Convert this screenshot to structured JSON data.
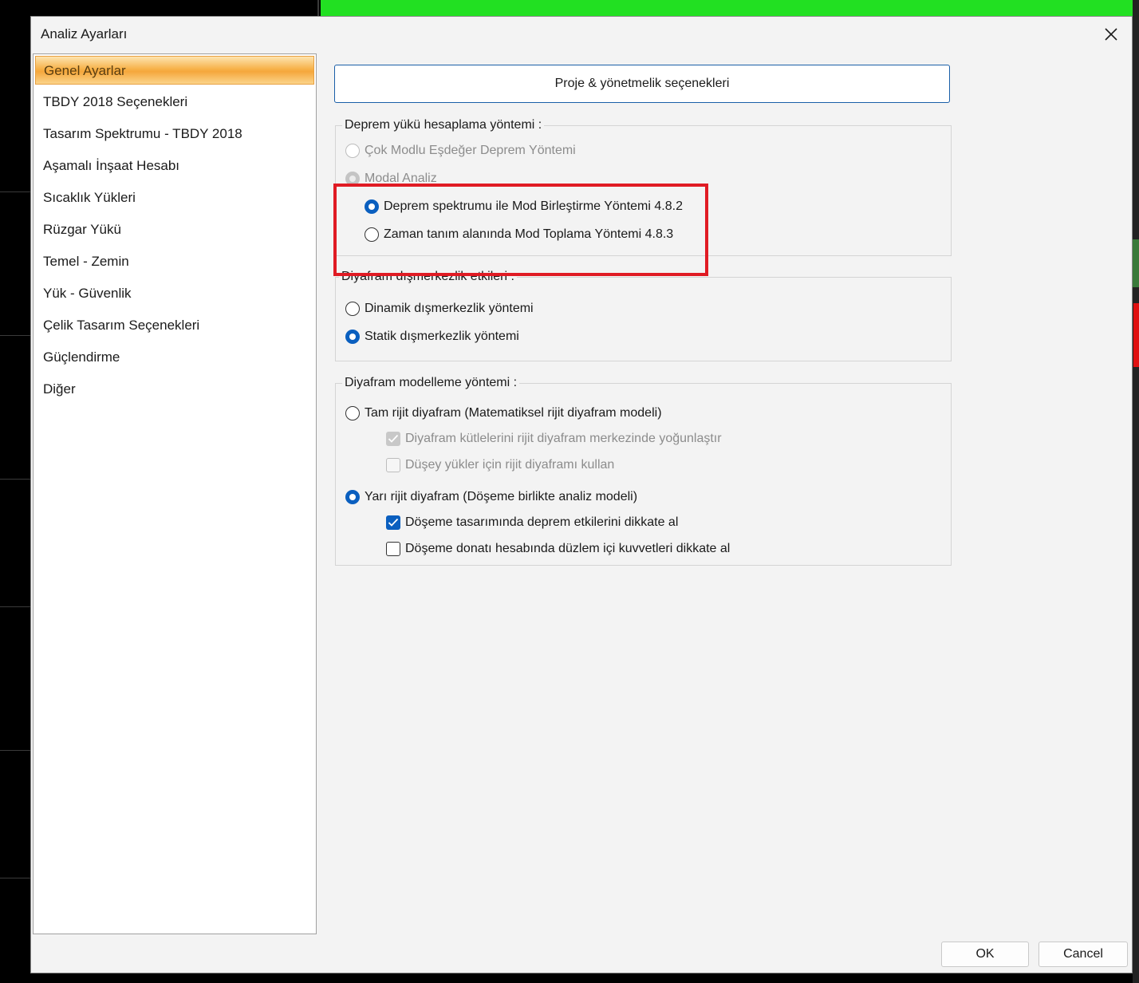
{
  "window": {
    "title": "Analiz Ayarları"
  },
  "sidebar": {
    "items": [
      {
        "label": "Genel Ayarlar",
        "active": true
      },
      {
        "label": "TBDY 2018 Seçenekleri"
      },
      {
        "label": "Tasarım Spektrumu - TBDY 2018"
      },
      {
        "label": "Aşamalı İnşaat Hesabı"
      },
      {
        "label": "Sıcaklık Yükleri"
      },
      {
        "label": "Rüzgar Yükü"
      },
      {
        "label": "Temel - Zemin"
      },
      {
        "label": "Yük - Güvenlik"
      },
      {
        "label": "Çelik Tasarım Seçenekleri"
      },
      {
        "label": "Güçlendirme"
      },
      {
        "label": "Diğer"
      }
    ]
  },
  "main": {
    "proje_button": "Proje & yönetmelik seçenekleri",
    "deprem_group": {
      "title": "Deprem yükü hesaplama yöntemi :",
      "cok_modlu": "Çok Modlu Eşdeğer Deprem Yöntemi",
      "modal_analiz": "Modal Analiz",
      "spektrum": "Deprem spektrumu ile Mod Birleştirme Yöntemi 4.8.2",
      "zaman": "Zaman tanım alanında Mod Toplama Yöntemi 4.8.3"
    },
    "diyafram_dis_group": {
      "title": "Diyafram dışmerkezlik etkileri :",
      "dinamik": "Dinamik dışmerkezlik yöntemi",
      "statik": "Statik dışmerkezlik yöntemi"
    },
    "diyafram_model_group": {
      "title": "Diyafram modelleme yöntemi  :",
      "tam_rijit": "Tam rijit diyafram (Matematiksel rijit diyafram modeli)",
      "kutle": "Diyafram kütlelerini rijit diyafram merkezinde yoğunlaştır",
      "dusey": "Düşey yükler için rijit diyaframı kullan",
      "yari_rijit": "Yarı rijit diyafram (Döşeme birlikte analiz modeli)",
      "doseme_deprem": "Döşeme tasarımında deprem etkilerini dikkate al",
      "doseme_donati": "Döşeme donatı hesabında düzlem içi kuvvetleri dikkate al"
    }
  },
  "footer": {
    "ok": "OK",
    "cancel": "Cancel"
  },
  "colors": {
    "accent": "#0a5fbf",
    "highlight": "#e01b24",
    "active_item": "#f5a73c"
  }
}
